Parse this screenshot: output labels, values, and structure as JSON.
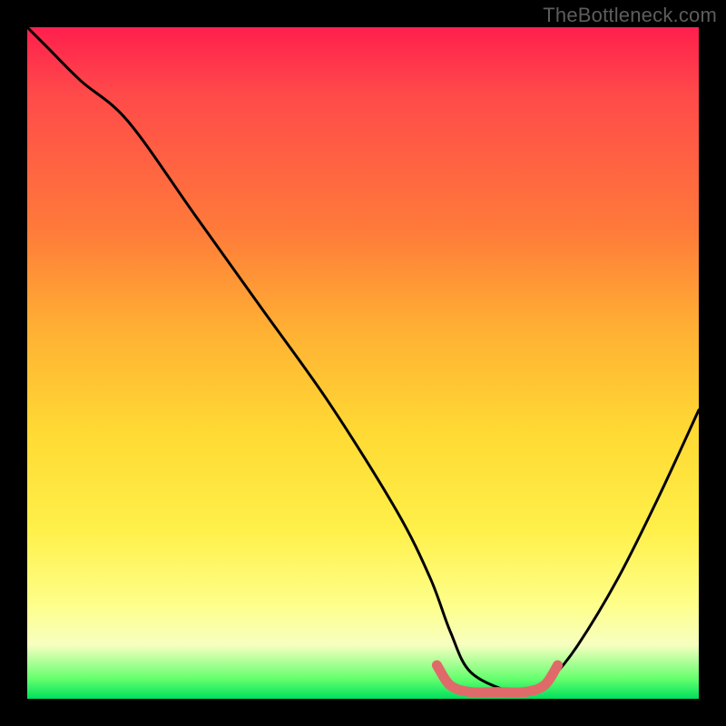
{
  "watermark": "TheBottleneck.com",
  "chart_data": {
    "type": "line",
    "title": "",
    "xlabel": "",
    "ylabel": "",
    "xlim": [
      0,
      100
    ],
    "ylim": [
      0,
      100
    ],
    "grid": false,
    "series": [
      {
        "name": "bottleneck-curve",
        "color": "#000000",
        "x": [
          0,
          3,
          8,
          15,
          25,
          35,
          45,
          55,
          60,
          63,
          66,
          72,
          75,
          78,
          82,
          88,
          94,
          100
        ],
        "values": [
          100,
          97,
          92,
          86,
          72,
          58,
          44,
          28,
          18,
          10,
          4,
          1,
          1,
          3,
          8,
          18,
          30,
          43
        ]
      },
      {
        "name": "optimal-range-marker",
        "color": "#e06a6a",
        "x": [
          61,
          63,
          66,
          70,
          74,
          77,
          79
        ],
        "values": [
          5,
          2,
          1,
          1,
          1,
          2,
          5
        ]
      }
    ],
    "gradient_stops": [
      {
        "pos": 0,
        "color": "#ff1f4d"
      },
      {
        "pos": 10,
        "color": "#ff4a4a"
      },
      {
        "pos": 30,
        "color": "#ff7a3a"
      },
      {
        "pos": 45,
        "color": "#ffb033"
      },
      {
        "pos": 60,
        "color": "#ffd933"
      },
      {
        "pos": 75,
        "color": "#fff04a"
      },
      {
        "pos": 86,
        "color": "#feff8a"
      },
      {
        "pos": 92,
        "color": "#f6ffc0"
      },
      {
        "pos": 97,
        "color": "#65ff6e"
      },
      {
        "pos": 100,
        "color": "#00e05c"
      }
    ]
  }
}
